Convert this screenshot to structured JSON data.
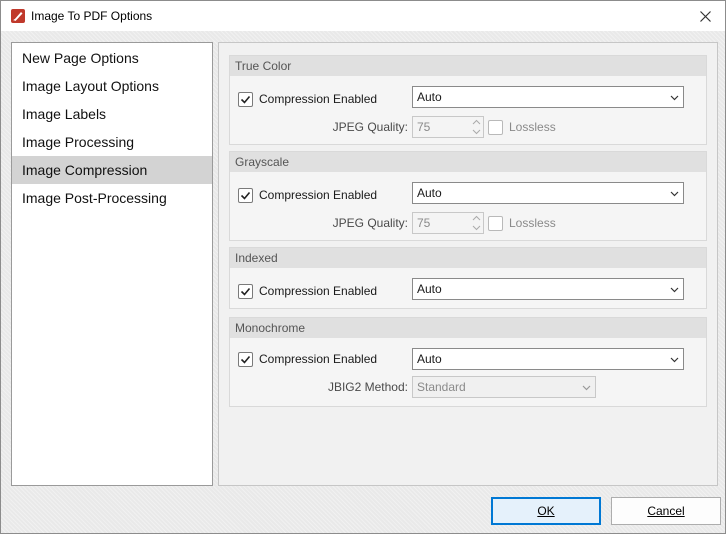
{
  "window": {
    "title": "Image To PDF Options"
  },
  "nav": {
    "items": [
      {
        "label": "New Page Options"
      },
      {
        "label": "Image Layout Options"
      },
      {
        "label": "Image Labels"
      },
      {
        "label": "Image Processing"
      },
      {
        "label": "Image Compression",
        "selected": true
      },
      {
        "label": "Image Post-Processing"
      }
    ]
  },
  "groups": {
    "true_color": {
      "title": "True Color",
      "compression_label": "Compression Enabled",
      "compression_checked": true,
      "compression_value": "Auto",
      "jpeg_quality_label": "JPEG Quality:",
      "jpeg_quality_value": "75",
      "lossless_label": "Lossless",
      "lossless_checked": false
    },
    "grayscale": {
      "title": "Grayscale",
      "compression_label": "Compression Enabled",
      "compression_checked": true,
      "compression_value": "Auto",
      "jpeg_quality_label": "JPEG Quality:",
      "jpeg_quality_value": "75",
      "lossless_label": "Lossless",
      "lossless_checked": false
    },
    "indexed": {
      "title": "Indexed",
      "compression_label": "Compression Enabled",
      "compression_checked": true,
      "compression_value": "Auto"
    },
    "monochrome": {
      "title": "Monochrome",
      "compression_label": "Compression Enabled",
      "compression_checked": true,
      "compression_value": "Auto",
      "jbig2_label": "JBIG2 Method:",
      "jbig2_value": "Standard"
    }
  },
  "buttons": {
    "ok": "OK",
    "cancel": "Cancel"
  },
  "colors": {
    "accent": "#0078d4",
    "selected_nav": "#d3d3d3",
    "app_icon": "#c0392b"
  }
}
